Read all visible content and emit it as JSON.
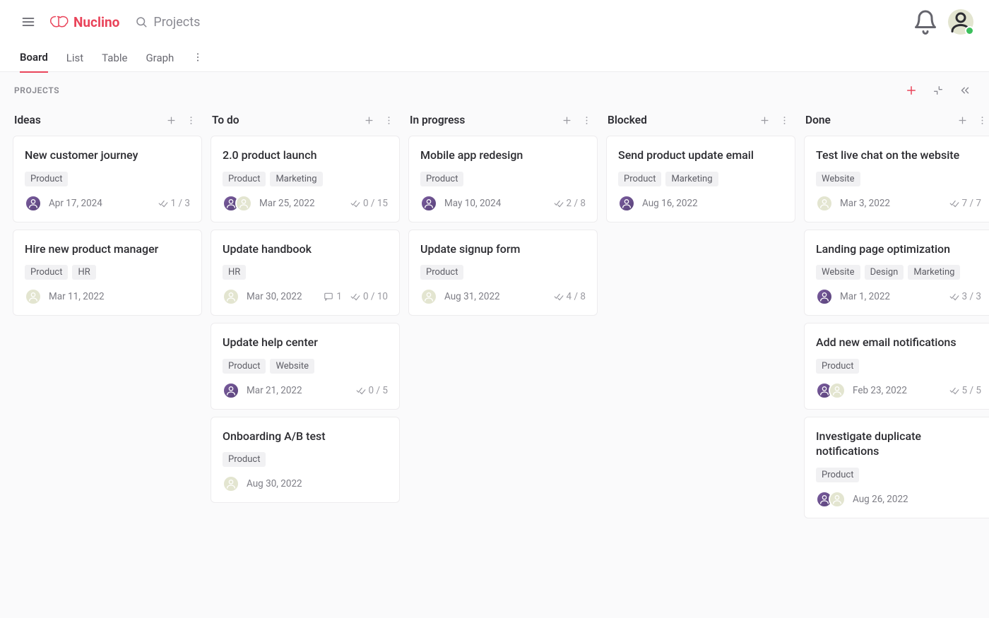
{
  "app": {
    "name": "Nuclino"
  },
  "search": {
    "placeholder": "Projects"
  },
  "tabs": [
    {
      "label": "Board",
      "active": true
    },
    {
      "label": "List",
      "active": false
    },
    {
      "label": "Table",
      "active": false
    },
    {
      "label": "Graph",
      "active": false
    }
  ],
  "board": {
    "title": "PROJECTS",
    "columns": [
      {
        "title": "Ideas",
        "cards": [
          {
            "title": "New customer journey",
            "tags": [
              "Product"
            ],
            "avatars": [
              "purple"
            ],
            "date": "Apr 17, 2024",
            "progress": "1 / 3"
          },
          {
            "title": "Hire new product manager",
            "tags": [
              "Product",
              "HR"
            ],
            "avatars": [
              "tan"
            ],
            "date": "Mar 11, 2022"
          }
        ]
      },
      {
        "title": "To do",
        "cards": [
          {
            "title": "2.0 product launch",
            "tags": [
              "Product",
              "Marketing"
            ],
            "avatars": [
              "purple",
              "tan"
            ],
            "date": "Mar 25, 2022",
            "progress": "0 / 15"
          },
          {
            "title": "Update handbook",
            "tags": [
              "HR"
            ],
            "avatars": [
              "tan"
            ],
            "date": "Mar 30, 2022",
            "comments": "1",
            "progress": "0 / 10"
          },
          {
            "title": "Update help center",
            "tags": [
              "Product",
              "Website"
            ],
            "avatars": [
              "purple"
            ],
            "date": "Mar 21, 2022",
            "progress": "0 / 5"
          },
          {
            "title": "Onboarding A/B test",
            "tags": [
              "Product"
            ],
            "avatars": [
              "tan"
            ],
            "date": "Aug 30, 2022"
          }
        ]
      },
      {
        "title": "In progress",
        "cards": [
          {
            "title": "Mobile app redesign",
            "tags": [
              "Product"
            ],
            "avatars": [
              "purple"
            ],
            "date": "May 10, 2024",
            "progress": "2 / 8"
          },
          {
            "title": "Update signup form",
            "tags": [
              "Product"
            ],
            "avatars": [
              "tan"
            ],
            "date": "Aug 31, 2022",
            "progress": "4 / 8"
          }
        ]
      },
      {
        "title": "Blocked",
        "cards": [
          {
            "title": "Send product update email",
            "tags": [
              "Product",
              "Marketing"
            ],
            "avatars": [
              "purple"
            ],
            "date": "Aug 16, 2022"
          }
        ]
      },
      {
        "title": "Done",
        "cards": [
          {
            "title": "Test live chat on the website",
            "tags": [
              "Website"
            ],
            "avatars": [
              "tan"
            ],
            "date": "Mar 3, 2022",
            "progress": "7 / 7"
          },
          {
            "title": "Landing page optimization",
            "tags": [
              "Website",
              "Design",
              "Marketing"
            ],
            "avatars": [
              "purple"
            ],
            "date": "Mar 1, 2022",
            "progress": "3 / 3"
          },
          {
            "title": "Add new email notifications",
            "tags": [
              "Product"
            ],
            "avatars": [
              "purple",
              "tan"
            ],
            "date": "Feb 23, 2022",
            "progress": "5 / 5"
          },
          {
            "title": "Investigate duplicate notifications",
            "tags": [
              "Product"
            ],
            "avatars": [
              "purple",
              "tan"
            ],
            "date": "Aug 26, 2022"
          }
        ]
      }
    ]
  }
}
